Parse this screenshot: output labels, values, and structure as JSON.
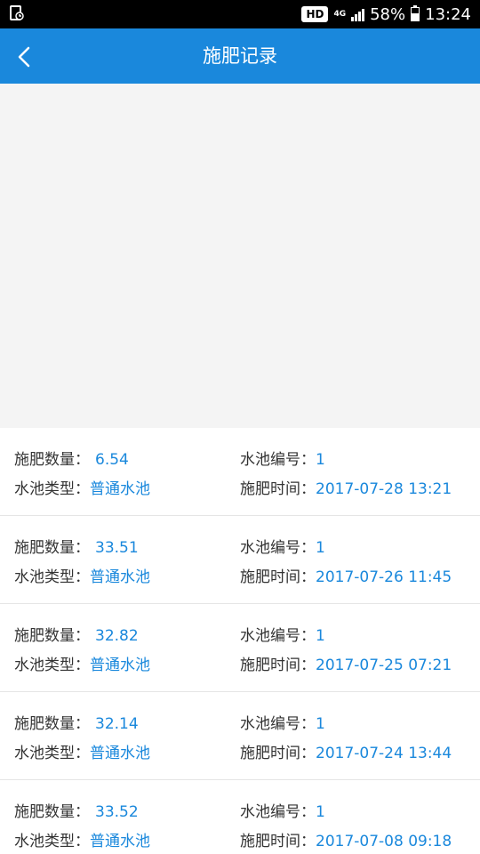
{
  "status_bar": {
    "hd": "HD",
    "network": "4G",
    "battery": "58%",
    "battery_level": 0.58,
    "time": "13:24"
  },
  "header": {
    "title": "施肥记录",
    "back_icon": "chevron-left-icon"
  },
  "labels": {
    "amount": "施肥数量：",
    "pool_type": "水池类型：",
    "pool_no": "水池编号：",
    "time": "施肥时间："
  },
  "records": [
    {
      "amount": "6.54",
      "pool_type": "普通水池",
      "pool_no": "1",
      "time": "2017-07-28 13:21"
    },
    {
      "amount": "33.51",
      "pool_type": "普通水池",
      "pool_no": "1",
      "time": "2017-07-26 11:45"
    },
    {
      "amount": "32.82",
      "pool_type": "普通水池",
      "pool_no": "1",
      "time": "2017-07-25 07:21"
    },
    {
      "amount": "32.14",
      "pool_type": "普通水池",
      "pool_no": "1",
      "time": "2017-07-24 13:44"
    },
    {
      "amount": "33.52",
      "pool_type": "普通水池",
      "pool_no": "1",
      "time": "2017-07-08 09:18"
    }
  ],
  "colors": {
    "accent": "#1a88dc",
    "status_bar": "#000000"
  }
}
